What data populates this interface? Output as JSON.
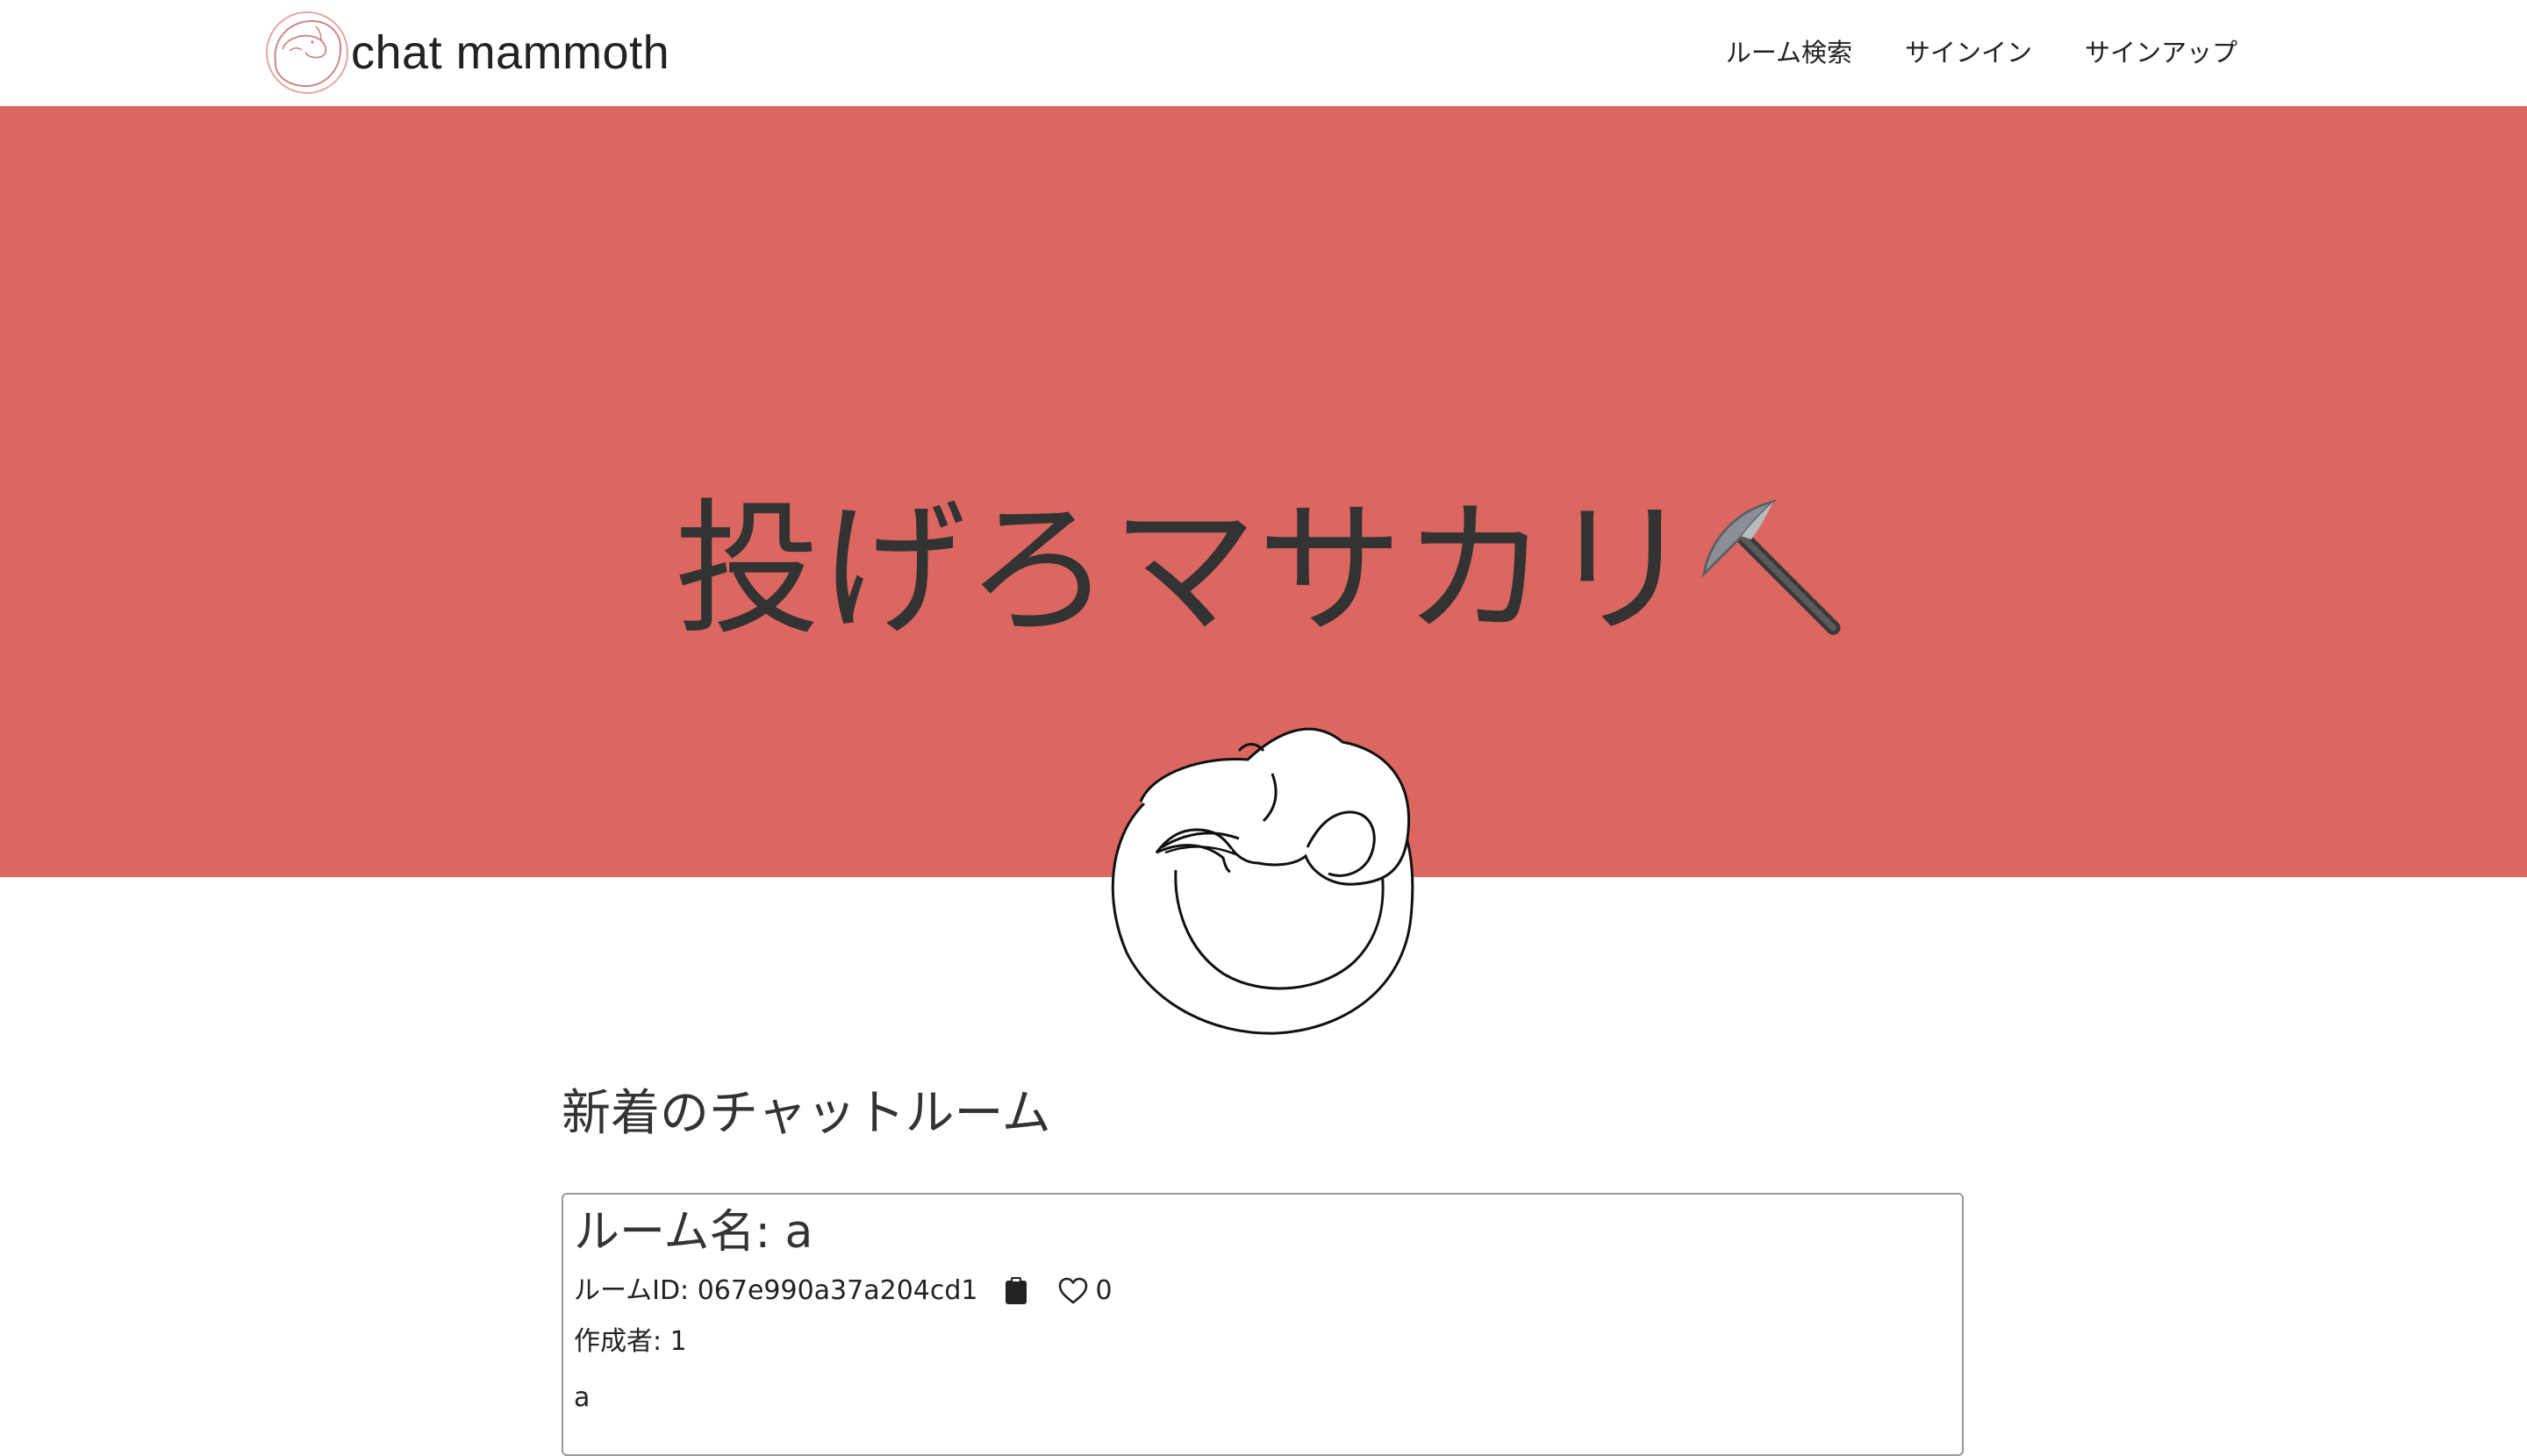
{
  "navbar": {
    "brand": "chat mammoth",
    "logo_icon": "mammoth-logo-icon",
    "links": [
      {
        "label": "ルーム検索"
      },
      {
        "label": "サインイン"
      },
      {
        "label": "サインアップ"
      }
    ]
  },
  "hero": {
    "title": "投げろマサカリ",
    "emoji_icon": "pickaxe-icon",
    "background": "#dc6761",
    "mascot_icon": "mammoth-mascot-icon"
  },
  "rooms_section": {
    "title": "新着のチャットルーム",
    "rooms": [
      {
        "name": "ルーム名: a",
        "id_text": "ルームID: 067e990a37a204cd1",
        "copy_icon": "clipboard-icon",
        "like_icon": "heart-icon",
        "likes": "0",
        "creator": "作成者: 1",
        "description": "a"
      }
    ]
  }
}
